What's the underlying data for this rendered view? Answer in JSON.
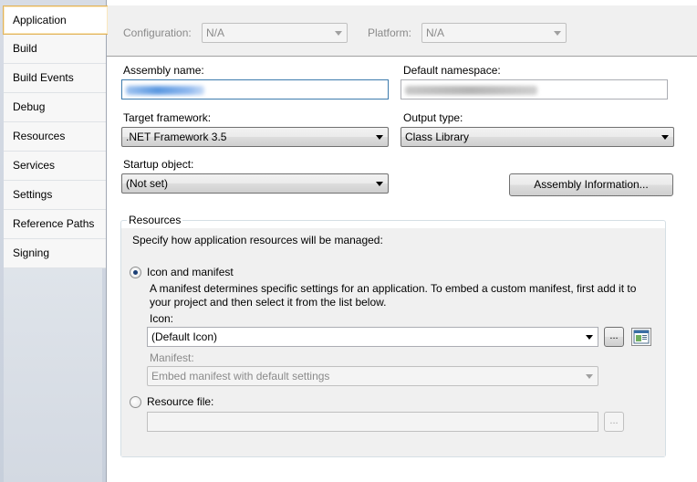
{
  "tabs": [
    {
      "label": "Application",
      "active": true
    },
    {
      "label": "Build"
    },
    {
      "label": "Build Events"
    },
    {
      "label": "Debug"
    },
    {
      "label": "Resources"
    },
    {
      "label": "Services"
    },
    {
      "label": "Settings"
    },
    {
      "label": "Reference Paths"
    },
    {
      "label": "Signing"
    }
  ],
  "config": {
    "configuration_label": "Configuration:",
    "configuration_value": "N/A",
    "platform_label": "Platform:",
    "platform_value": "N/A"
  },
  "form": {
    "assembly_name_label": "Assembly name:",
    "default_namespace_label": "Default namespace:",
    "target_framework_label": "Target framework:",
    "target_framework_value": ".NET Framework 3.5",
    "output_type_label": "Output type:",
    "output_type_value": "Class Library",
    "startup_object_label": "Startup object:",
    "startup_object_value": "(Not set)",
    "assembly_info_button": "Assembly Information..."
  },
  "resources": {
    "group_title": "Resources",
    "description": "Specify how application resources will be managed:",
    "icon_manifest_label": "Icon and manifest",
    "icon_manifest_desc_line1": "A manifest determines specific settings for an application. To embed a custom manifest, first add it to",
    "icon_manifest_desc_line2": "your project and then select it from the list below.",
    "icon_label": "Icon:",
    "icon_value": "(Default Icon)",
    "browse_button": "...",
    "manifest_label": "Manifest:",
    "manifest_value": "Embed manifest with default settings",
    "resource_file_label": "Resource file:",
    "resource_browse_button": "..."
  },
  "icons": {
    "dropdown": "chevron-down-icon",
    "radio": "radio-icon",
    "icon_preview": "application-icon"
  },
  "colors": {
    "active_tab_border": "#e1b35b",
    "sidebar_bg": "#cdd4df",
    "radio_dot": "#1b3f76"
  }
}
